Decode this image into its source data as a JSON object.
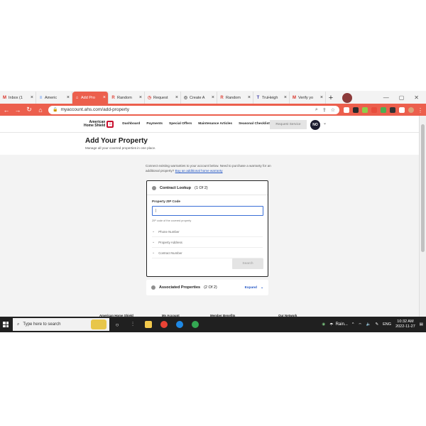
{
  "browser": {
    "tabs": [
      {
        "title": "Inbox (1",
        "icon_letter": "M",
        "icon_color": "#d93025",
        "active": false
      },
      {
        "title": "Americ",
        "icon_letter": "≡",
        "icon_color": "#4285f4",
        "active": false
      },
      {
        "title": "Add Pro",
        "icon_letter": "⌂",
        "icon_color": "#c8102e",
        "active": true
      },
      {
        "title": "Random",
        "icon_letter": "R",
        "icon_color": "#e0443a",
        "active": false
      },
      {
        "title": "Request",
        "icon_letter": "◷",
        "icon_color": "#e0443a",
        "active": false
      },
      {
        "title": "Create A",
        "icon_letter": "◎",
        "icon_color": "#555555",
        "active": false
      },
      {
        "title": "Random",
        "icon_letter": "R",
        "icon_color": "#e0443a",
        "active": false
      },
      {
        "title": "TruHeigh",
        "icon_letter": "T",
        "icon_color": "#3b3ba8",
        "active": false
      },
      {
        "title": "Verify yo",
        "icon_letter": "M",
        "icon_color": "#d93025",
        "active": false
      }
    ],
    "close_glyph": "×",
    "newtab_glyph": "+",
    "url": "myaccount.ahs.com/add-property",
    "accent_color": "#ec5f4d"
  },
  "site": {
    "logo_text_line1": "American",
    "logo_text_line2": "Home Shield",
    "nav": [
      "Dashboard",
      "Payments",
      "Special Offers",
      "Maintenance Articles",
      "Seasonal Checklist"
    ],
    "request_service": "Request Service",
    "user_initials": "NO",
    "page_title": "Add Your Property",
    "page_subtitle": "Manage all your covered properties in one place.",
    "intro_text": "Connect existing warranties to your account below. Need to purchase a warranty for an additional property?",
    "intro_link": "Buy an additional home warranty",
    "lookup": {
      "title": "Contract Lookup",
      "step": "(1 Of 2)",
      "zip_label": "Property ZIP Code",
      "zip_value": "|",
      "zip_hint": "ZIP code of the covered property",
      "options": [
        "Phone Number",
        "Property Address",
        "Contract Number"
      ],
      "search_label": "Search"
    },
    "associated": {
      "title": "Associated Properties",
      "step": "(2 Of 2)",
      "expand_label": "Expand"
    },
    "footer_peek": [
      "American Home Shield",
      "My Account",
      "Member Benefits",
      "Our Network"
    ]
  },
  "taskbar": {
    "search_placeholder": "Type here to search",
    "weather": "Rain...",
    "lang": "ENG",
    "time": "10:32 AM",
    "date": "2022-11-27"
  }
}
